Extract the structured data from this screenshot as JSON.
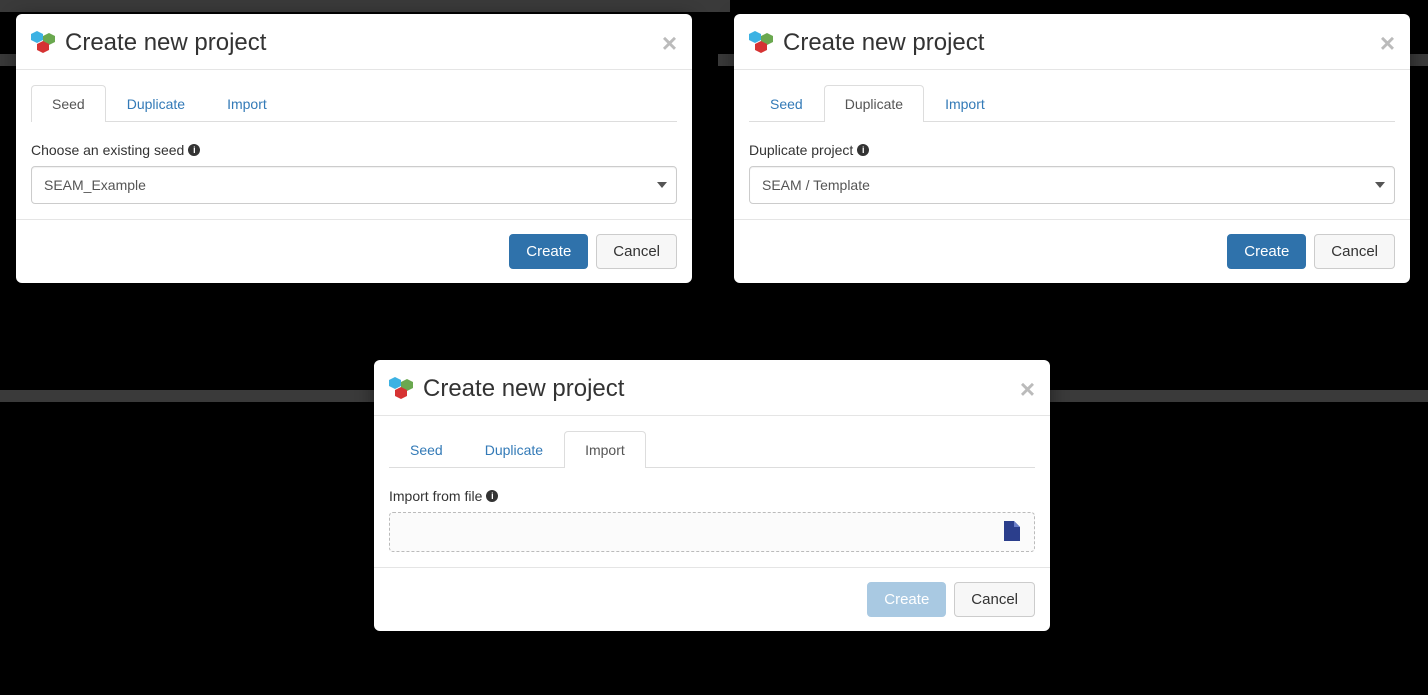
{
  "title": "Create new project",
  "tabs": {
    "seed": "Seed",
    "duplicate": "Duplicate",
    "import": "Import"
  },
  "seed_panel": {
    "label": "Choose an existing seed",
    "value": "SEAM_Example"
  },
  "duplicate_panel": {
    "label": "Duplicate project",
    "value": "SEAM / Template"
  },
  "import_panel": {
    "label": "Import from file"
  },
  "buttons": {
    "create": "Create",
    "cancel": "Cancel"
  }
}
